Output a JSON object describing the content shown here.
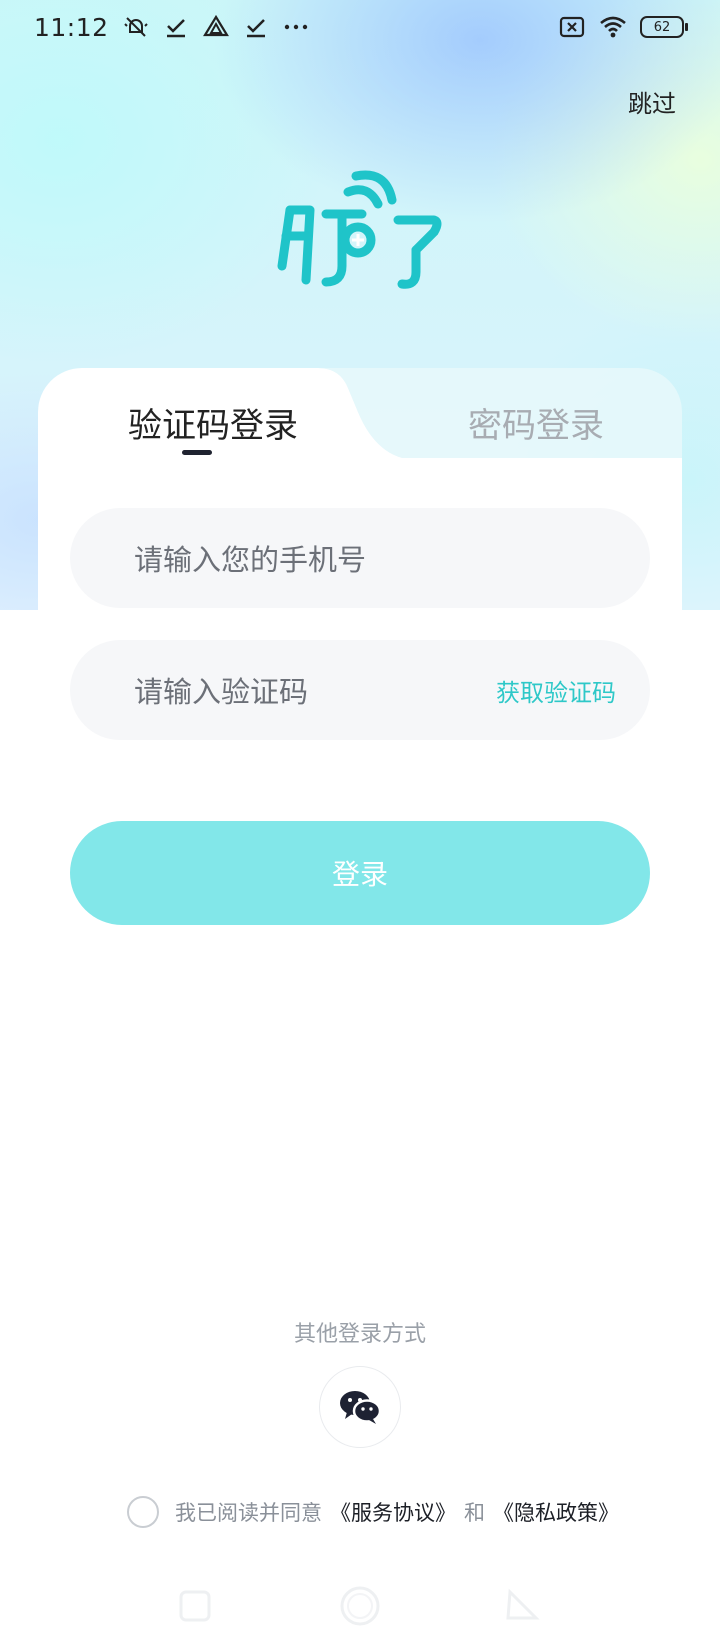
{
  "status_bar": {
    "time": "11:12",
    "battery": "62"
  },
  "header": {
    "skip_label": "跳过"
  },
  "tabs": {
    "active_label": "验证码登录",
    "inactive_label": "密码登录"
  },
  "form": {
    "phone_placeholder": "请输入您的手机号",
    "code_placeholder": "请输入验证码",
    "get_code_label": "获取验证码",
    "login_label": "登录"
  },
  "other_login": {
    "title": "其他登录方式",
    "wechat_icon": "wechat-icon"
  },
  "agreement": {
    "prefix": "我已阅读并同意",
    "service_link": "《服务协议》",
    "and": "和",
    "privacy_link": "《隐私政策》"
  },
  "colors": {
    "accent": "#2ec8c8",
    "button": "#82e7e9",
    "logo": "#1fc4c9"
  }
}
